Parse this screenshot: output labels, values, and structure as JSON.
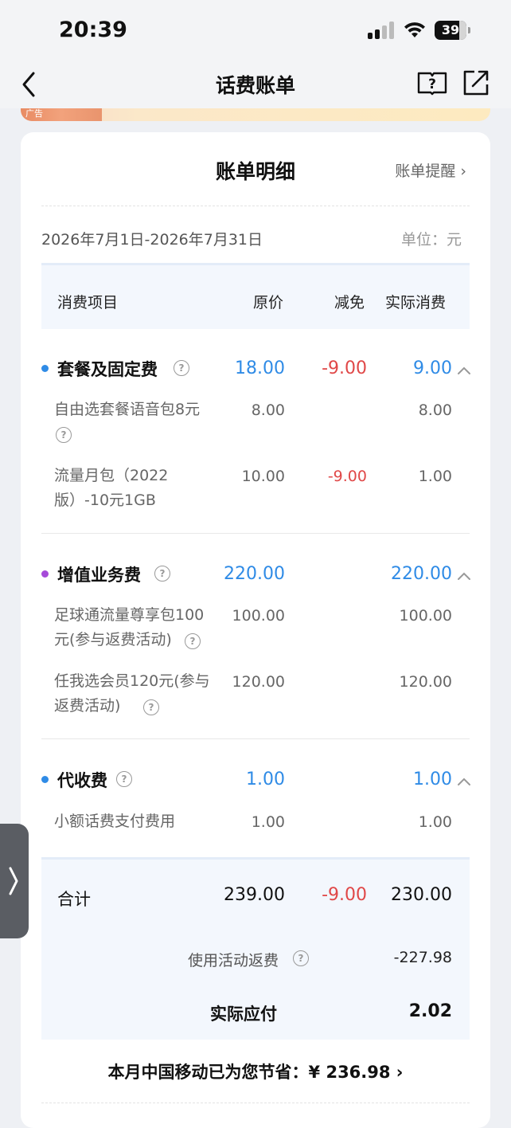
{
  "status_bar": {
    "time": "20:39",
    "battery": "39"
  },
  "nav": {
    "title": "话费账单"
  },
  "ad": {
    "label": "广告"
  },
  "card": {
    "title": "账单明细",
    "remind": "账单提醒 ›",
    "period": "2026年7月1日-2026年7月31日",
    "unit": "单位：元"
  },
  "table_header": {
    "item": "消费项目",
    "original": "原价",
    "discount": "减免",
    "actual": "实际消费"
  },
  "categories": [
    {
      "name": "套餐及固定费",
      "dot_color": "#2f8be6",
      "original": "18.00",
      "discount": "-9.00",
      "actual": "9.00",
      "items": [
        {
          "name": "自由选套餐语音包8元",
          "original": "8.00",
          "discount": "",
          "actual": "8.00"
        },
        {
          "name": "流量月包（2022版）-10元1GB",
          "original": "10.00",
          "discount": "-9.00",
          "actual": "1.00"
        }
      ]
    },
    {
      "name": "增值业务费",
      "dot_color": "#a64ad9",
      "original": "220.00",
      "discount": "",
      "actual": "220.00",
      "items": [
        {
          "name": "足球通流量尊享包100元(参与返费活动)",
          "original": "100.00",
          "discount": "",
          "actual": "100.00"
        },
        {
          "name": "任我选会员120元(参与返费活动)",
          "original": "120.00",
          "discount": "",
          "actual": "120.00"
        }
      ]
    },
    {
      "name": "代收费",
      "dot_color": "#2f8be6",
      "original": "1.00",
      "discount": "",
      "actual": "1.00",
      "items": [
        {
          "name": "小额话费支付费用",
          "original": "1.00",
          "discount": "",
          "actual": "1.00"
        }
      ]
    }
  ],
  "total": {
    "label": "合计",
    "original": "239.00",
    "discount": "-9.00",
    "actual": "230.00",
    "rebate_label": "使用活动返费",
    "rebate_value": "-227.98",
    "pay_label": "实际应付",
    "pay_value": "2.02"
  },
  "savings": {
    "text": "本月中国移动已为您节省：¥ 236.98 ›"
  },
  "colors": {
    "blue": "#2f8be6",
    "red": "#e04848",
    "purple": "#a64ad9"
  },
  "icons": [
    "back-icon",
    "help-book-icon",
    "share-icon",
    "question-icon",
    "chevron-up-icon",
    "side-expand-icon"
  ]
}
